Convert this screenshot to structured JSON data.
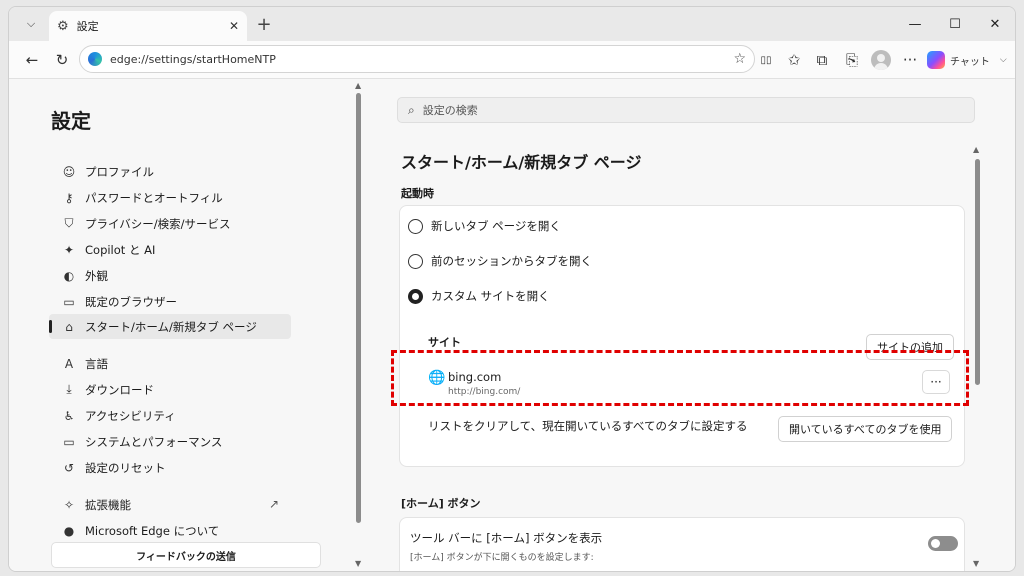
{
  "window": {
    "tab_title": "設定",
    "tab_icon": "gear-icon",
    "close_tab": "✕",
    "new_tab": "+",
    "tab_list": "⌵",
    "minimize": "—",
    "maximize": "☐",
    "close": "✕"
  },
  "toolbar": {
    "back": "←",
    "refresh": "↻",
    "address": "edge://settings/startHomeNTP",
    "favorite": "☆",
    "split": "▯▯",
    "favorites": "✩",
    "collections": "⧉",
    "screenshot": "⎘",
    "more": "···",
    "copilot_label": "チャット",
    "copilot_chevron": "⌵"
  },
  "sidebar": {
    "title": "設定",
    "items": [
      {
        "label": "プロファイル",
        "icon": "☺"
      },
      {
        "label": "パスワードとオートフィル",
        "icon": "⚷"
      },
      {
        "label": "プライバシー/検索/サービス",
        "icon": "⛉"
      },
      {
        "label": "Copilot と AI",
        "icon": "✦"
      },
      {
        "label": "外観",
        "icon": "◐"
      },
      {
        "label": "既定のブラウザー",
        "icon": "▭"
      },
      {
        "label": "スタート/ホーム/新規タブ ページ",
        "icon": "⌂"
      },
      {
        "label": "言語",
        "icon": "A"
      },
      {
        "label": "ダウンロード",
        "icon": "⤓"
      },
      {
        "label": "アクセシビリティ",
        "icon": "♿"
      },
      {
        "label": "システムとパフォーマンス",
        "icon": "▭"
      },
      {
        "label": "設定のリセット",
        "icon": "↺"
      },
      {
        "label": "拡張機能",
        "icon": "✧"
      },
      {
        "label": "Microsoft Edge について",
        "icon": "●"
      }
    ],
    "external_link": "↗",
    "feedback": "フィードバックの送信",
    "scroll_up": "▲",
    "scroll_down": "▼"
  },
  "main": {
    "search_placeholder": "設定の検索",
    "search_icon": "⌕",
    "page_title": "スタート/ホーム/新規タブ ページ",
    "startup_label": "起動時",
    "options": [
      {
        "label": "新しいタブ ページを開く",
        "checked": false
      },
      {
        "label": "前のセッションからタブを開く",
        "checked": false
      },
      {
        "label": "カスタム サイトを開く",
        "checked": true
      }
    ],
    "sites_label": "サイト",
    "add_site": "サイトの追加",
    "site": {
      "name": "bing.com",
      "url": "http://bing.com/",
      "more": "···",
      "icon": "🌐"
    },
    "clear_text": "リストをクリアして、現在開いているすべてのタブに設定する",
    "use_all_tabs": "開いているすべてのタブを使用",
    "home_section": "[ホーム] ボタン",
    "home_toggle_title": "ツール バーに [ホーム] ボタンを表示",
    "home_toggle_sub": "[ホーム] ボタンが下に開くものを設定します:",
    "scroll_up": "▲",
    "scroll_down": "▼"
  }
}
